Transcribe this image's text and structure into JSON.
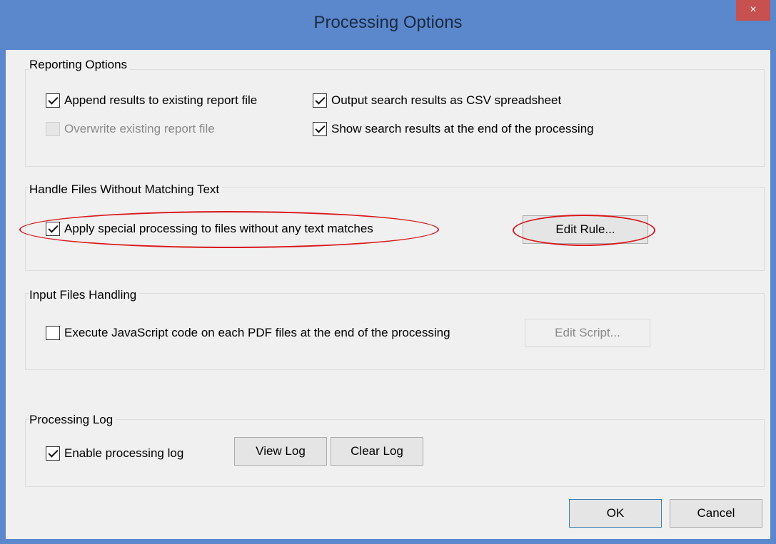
{
  "window": {
    "title": "Processing Options",
    "close_symbol": "×"
  },
  "reporting": {
    "label": "Reporting Options",
    "append": {
      "label": "Append results to existing report file",
      "checked": true
    },
    "overwrite": {
      "label": "Overwrite existing report file",
      "checked": false,
      "disabled": true
    },
    "csv": {
      "label": "Output search results as CSV spreadsheet",
      "checked": true
    },
    "show_results": {
      "label": "Show search results at the end of the processing",
      "checked": true
    }
  },
  "handle_files": {
    "label": "Handle Files Without Matching Text",
    "apply": {
      "label": "Apply special processing to files without any text matches",
      "checked": true
    },
    "edit_rule_label": "Edit Rule..."
  },
  "input_files": {
    "label": "Input Files Handling",
    "execute_js": {
      "label": "Execute JavaScript code on each PDF files at the end of the processing",
      "checked": false
    },
    "edit_script_label": "Edit Script..."
  },
  "processing_log": {
    "label": "Processing Log",
    "enable": {
      "label": "Enable processing log",
      "checked": true
    },
    "view_log_label": "View Log",
    "clear_log_label": "Clear Log"
  },
  "footer": {
    "ok_label": "OK",
    "cancel_label": "Cancel"
  },
  "colors": {
    "title_bar": "#5b87cc",
    "close_button": "#c75050",
    "annotation": "#d8181e"
  }
}
